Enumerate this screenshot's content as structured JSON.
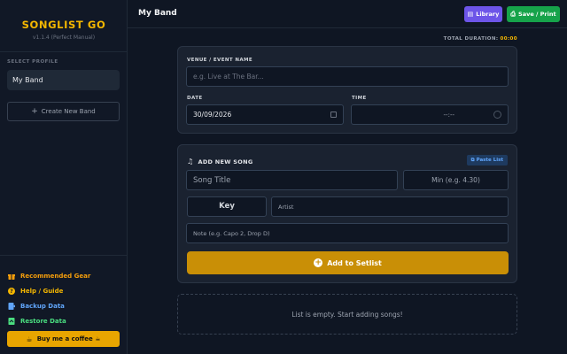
{
  "sidebar": {
    "brand": "SONGLIST GO",
    "version": "v1.1.4 (Perfect Manual)",
    "profile_label": "SELECT PROFILE",
    "profile": "My Band",
    "create_band": "Create New Band",
    "links": [
      {
        "label": "Recommended Gear",
        "icon": "gift-icon",
        "color": "#f59e0b"
      },
      {
        "label": "Help / Guide",
        "icon": "help-icon",
        "color": "#f5b700"
      },
      {
        "label": "Backup Data",
        "icon": "backup-icon",
        "color": "#60a5fa"
      },
      {
        "label": "Restore Data",
        "icon": "restore-icon",
        "color": "#4ade80"
      }
    ],
    "coffee": "Buy me a coffee ☕"
  },
  "header": {
    "title": "My Band",
    "library": "Library",
    "save": "Save / Print"
  },
  "duration": {
    "label": "TOTAL DURATION:",
    "value": "00:00"
  },
  "event": {
    "venue_label": "VENUE / EVENT NAME",
    "venue_placeholder": "e.g. Live at The Bar...",
    "date_label": "DATE",
    "date_value": "30/09/2026",
    "time_label": "TIME",
    "time_value": "--:--"
  },
  "song": {
    "heading": "ADD NEW SONG",
    "paste": "Paste List",
    "title_placeholder": "Song Title",
    "min_placeholder": "Min (e.g. 4.30)",
    "key": "Key",
    "artist_placeholder": "Artist",
    "note_placeholder": "Note (e.g. Capo 2, Drop D)",
    "add_button": "Add to Setlist"
  },
  "empty_message": "List is empty. Start adding songs!",
  "colors": {
    "accent": "#f5b700",
    "library": "#6d55e8",
    "save": "#16a34a",
    "add": "#c98f06"
  }
}
